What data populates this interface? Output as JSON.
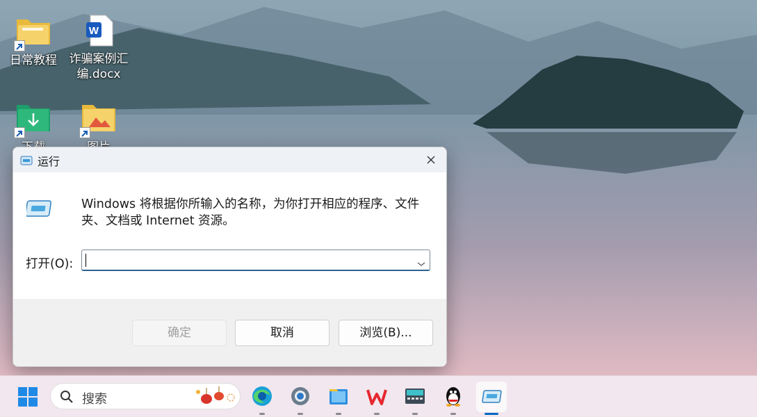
{
  "desktop": {
    "icons": [
      {
        "label": "日常教程",
        "icon": "folder-shortcut-icon"
      },
      {
        "label": "诈骗案例汇编.docx",
        "label_line1": "诈骗案例汇",
        "label_line2": "编.docx",
        "icon": "word-document-icon"
      },
      {
        "label": "下载",
        "icon": "downloads-folder-icon"
      },
      {
        "label": "图片",
        "icon": "pictures-folder-icon"
      }
    ]
  },
  "run_dialog": {
    "title": "运行",
    "description": "Windows 将根据你所输入的名称，为你打开相应的程序、文件夹、文档或 Internet 资源。",
    "description_line1": "Windows 将根据你所输入的名称，为你打开相应的程序、文件",
    "description_line2": "夹、文档或 Internet 资源。",
    "open_label": "打开(O):",
    "open_value": "",
    "buttons": {
      "ok": "确定",
      "cancel": "取消",
      "browse": "浏览(B)..."
    }
  },
  "taskbar": {
    "search_placeholder": "搜索",
    "apps": [
      "start-icon",
      "edge-icon",
      "settings-icon",
      "file-explorer-icon",
      "wps-icon",
      "keyboard-app-icon",
      "qq-icon",
      "run-icon"
    ],
    "active_app": "run-icon"
  },
  "colors": {
    "accent": "#0067c0",
    "taskbar_bg": "#f2e7ee",
    "dialog_footer": "#f0f0f0"
  }
}
